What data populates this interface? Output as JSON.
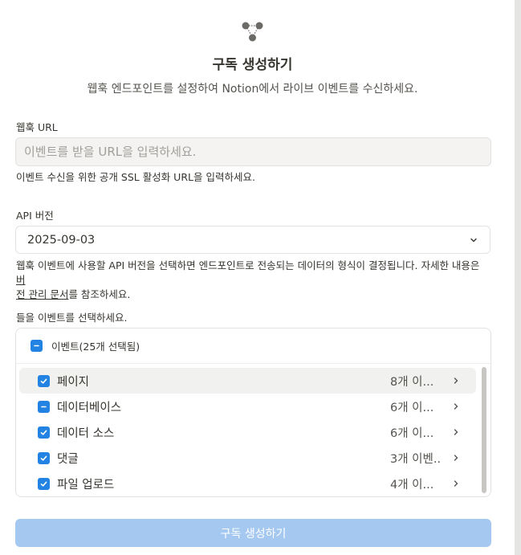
{
  "header": {
    "icon": "webhook-icon",
    "title": "구독 생성하기",
    "subtitle": "웹훅 엔드포인트를 설정하여 Notion에서 라이브 이벤트를 수신하세요."
  },
  "url_field": {
    "label": "웹훅 URL",
    "value": "",
    "placeholder": "이벤트를 받을 URL을 입력하세요.",
    "help": "이벤트 수신을 위한 공개 SSL 활성화 URL을 입력하세요."
  },
  "api_version": {
    "label": "API 버전",
    "selected": "2025-09-03",
    "help_line1_prefix": "웹훅 이벤트에 사용할 API 버전을 선택하면 엔드포인트로 전송되는 데이터의 형식이 결정됩니다. 자세한 내용은 ",
    "help_link_part1": "버",
    "help_link_part2": "전 관리 문서",
    "help_suffix": "를 참조하세요."
  },
  "events": {
    "label": "들을 이벤트를 선택하세요.",
    "header_label": "이벤트(25개 선택됨)",
    "header_state": "indeterminate",
    "items": [
      {
        "label": "페이지",
        "count": "8개 이...",
        "state": "checked"
      },
      {
        "label": "데이터베이스",
        "count": "6개 이...",
        "state": "indeterminate"
      },
      {
        "label": "데이터 소스",
        "count": "6개 이...",
        "state": "checked"
      },
      {
        "label": "댓글",
        "count": "3개 이벤...",
        "state": "checked"
      },
      {
        "label": "파일 업로드",
        "count": "4개 이...",
        "state": "checked"
      }
    ]
  },
  "submit": {
    "label": "구독 생성하기"
  },
  "colors": {
    "accent": "#2383e2",
    "submit_disabled": "#a5c8f1",
    "input_bg": "#f4f3f1"
  }
}
